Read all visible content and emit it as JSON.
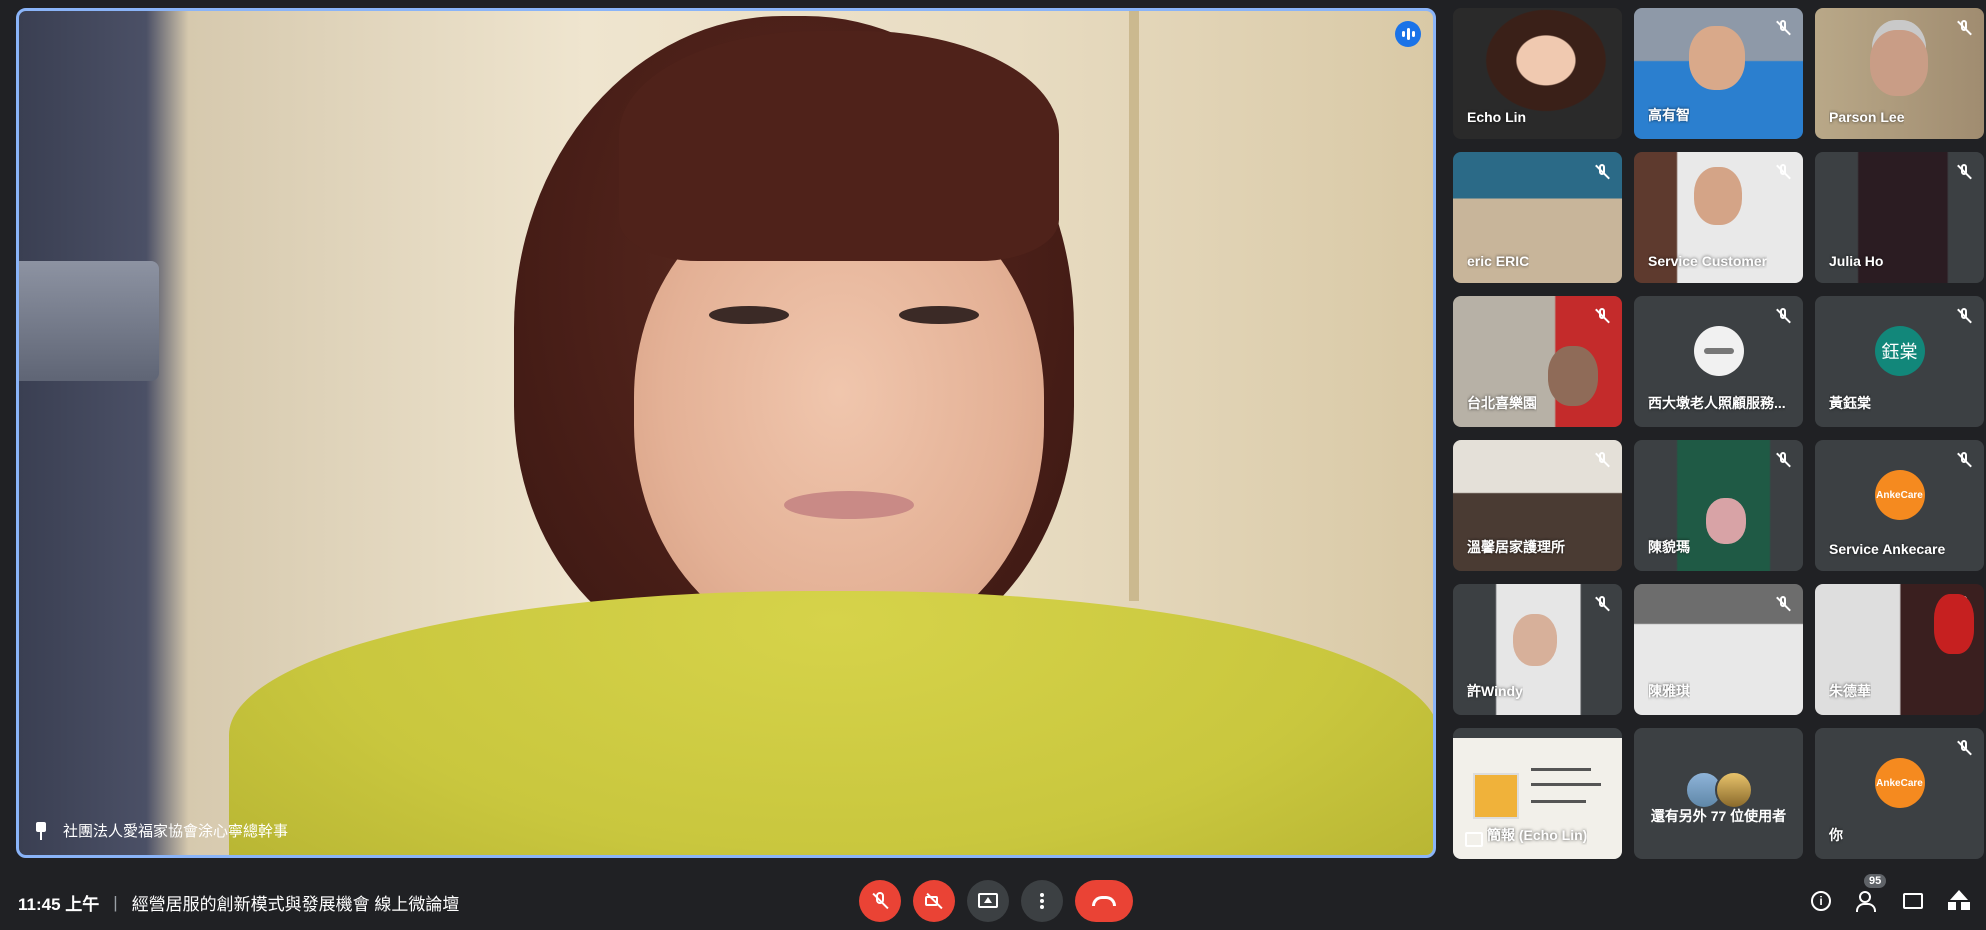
{
  "main_speaker": {
    "name": "社團法人愛福家協會涂心寧總幹事"
  },
  "participants": [
    {
      "name": "Echo Lin",
      "muted": false
    },
    {
      "name": "高有智",
      "muted": true
    },
    {
      "name": "Parson Lee",
      "muted": true
    },
    {
      "name": "eric ERIC",
      "muted": true
    },
    {
      "name": "Service Customer",
      "muted": true
    },
    {
      "name": "Julia Ho",
      "muted": true
    },
    {
      "name": "台北喜樂園",
      "muted": true
    },
    {
      "name": "西大墩老人照顧服務...",
      "muted": true,
      "avatar": "logo"
    },
    {
      "name": "黃鈺棠",
      "muted": true,
      "avatar_text": "鈺棠"
    },
    {
      "name": "溫馨居家護理所",
      "muted": true
    },
    {
      "name": "陳貌瑪",
      "muted": true
    },
    {
      "name": "Service Ankecare",
      "muted": true,
      "avatar_text": "AnkeCare"
    },
    {
      "name": "許Windy",
      "muted": true
    },
    {
      "name": "陳雅琪",
      "muted": true
    },
    {
      "name": "朱德華",
      "muted": true
    },
    {
      "name": "簡報 (Echo Lin)",
      "muted": false,
      "type": "presentation"
    },
    {
      "name": "還有另外 77 位使用者",
      "type": "more"
    },
    {
      "name": "你",
      "muted": true,
      "avatar_text": "AnkeCare"
    }
  ],
  "bottom_bar": {
    "time": "11:45 上午",
    "separator": "|",
    "meeting_title": "經營居服的創新模式與發展機會 線上微論壇",
    "participant_count": "95"
  },
  "icons": {
    "mic": "mic-off-icon",
    "camera": "camera-off-icon",
    "present": "present-screen-icon",
    "more": "more-vert-icon",
    "hangup": "call-end-icon",
    "info": "info-icon",
    "people": "people-icon",
    "chat": "chat-icon",
    "activities": "activities-icon"
  },
  "colors": {
    "background": "#202124",
    "tile": "#3c4043",
    "speaking_border": "#8ab4f8",
    "danger": "#ea4335",
    "speaking_indicator": "#1a73e8"
  }
}
